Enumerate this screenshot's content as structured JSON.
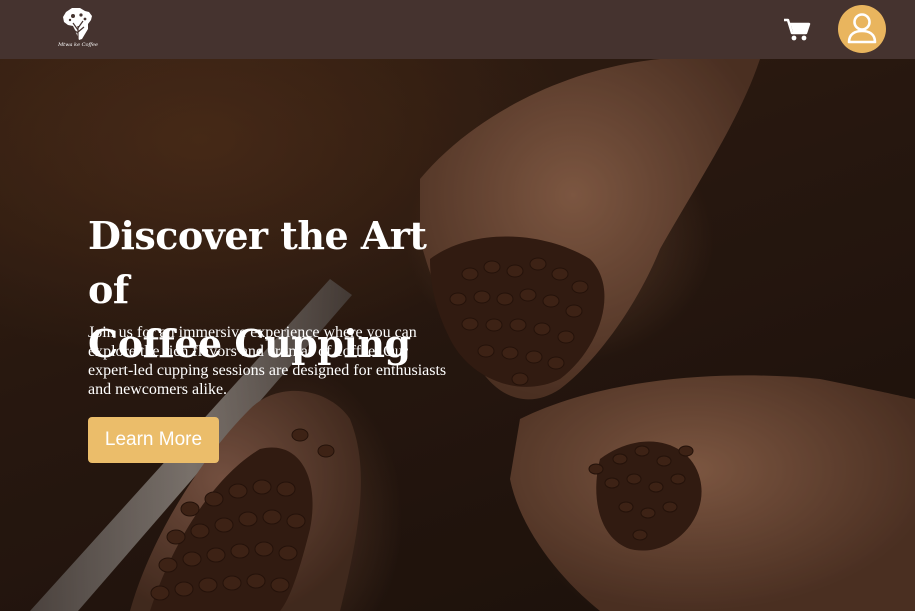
{
  "navbar": {
    "logo_text": "Mtwa ke Coffee",
    "logo_icon": "africa-tree-logo",
    "cart_icon": "cart-icon",
    "avatar_icon": "user-icon",
    "background_color": "#45332f",
    "avatar_color": "#e9b55e"
  },
  "hero": {
    "title": "Discover the Art of\nCoffee Cupping",
    "description": "Join us for an immersive experience where you can explore the rich flavors and aromas of coffee. Our expert-led cupping sessions are designed for enthusiasts and newcomers alike.",
    "button_label": "Learn More",
    "button_color": "#ebbd6a",
    "background_image": "hands-holding-coffee-beans"
  }
}
